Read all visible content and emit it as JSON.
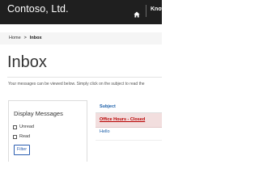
{
  "header": {
    "brand": "Contoso, Ltd.",
    "nav_label": "Know",
    "colors": {
      "background": "#1f1f1f",
      "text": "#ffffff"
    },
    "icons": [
      "home-icon"
    ]
  },
  "breadcrumb": {
    "home": "Home",
    "separator": ">",
    "current": "Inbox"
  },
  "page": {
    "title": "Inbox",
    "intro": "Your messages can be viewed below. Simply click on the subject to read the"
  },
  "filter_panel": {
    "heading": "Display Messages",
    "options": [
      {
        "label": "Unread",
        "checked": false
      },
      {
        "label": "Read",
        "checked": false
      }
    ],
    "button_label": "Filter"
  },
  "messages": {
    "column_header": "Subject",
    "rows": [
      {
        "subject": "Office Hours - Closed",
        "highlighted": true,
        "color": "#b80000"
      },
      {
        "subject": "Hello",
        "highlighted": false,
        "color": "#1a5ea8"
      }
    ],
    "highlight_color": "#f2dede"
  }
}
